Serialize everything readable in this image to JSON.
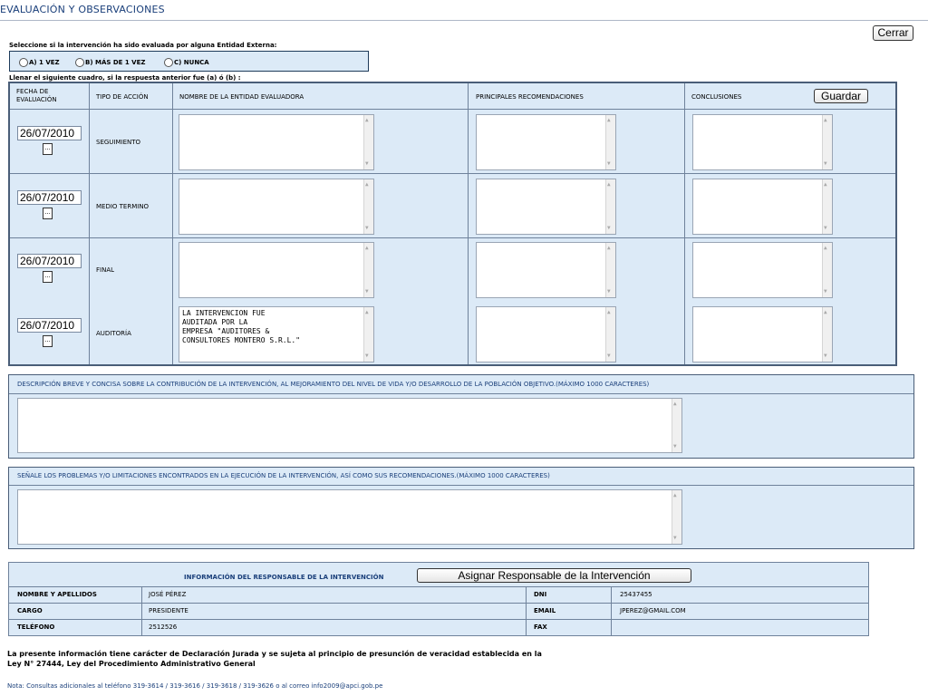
{
  "page": {
    "title": "EVALUACIÓN Y OBSERVACIONES",
    "close_label": "Cerrar"
  },
  "external_eval": {
    "question": "Seleccione si la intervención ha sido evaluada por alguna Entidad Externa:",
    "options": [
      "A) 1 VEZ",
      "B) MÁS DE 1 VEZ",
      "C) NUNCA"
    ],
    "fill_instruction": "Llenar el siguiente cuadro, si la respuesta anterior fue (a) ó (b) :"
  },
  "eval_table": {
    "headers": {
      "date": "FECHA DE EVALUACIÓN",
      "action": "TIPO DE ACCIÓN",
      "entity": "NOMBRE DE LA ENTIDAD EVALUADORA",
      "recommendations": "PRINCIPALES RECOMENDACIONES",
      "conclusions": "CONCLUSIONES"
    },
    "save_label": "Guardar",
    "calendar_button_label": "...",
    "rows": [
      {
        "date": "26/07/2010",
        "action": "SEGUIMIENTO",
        "entity": "",
        "recommendations": "",
        "conclusions": ""
      },
      {
        "date": "26/07/2010",
        "action": "MEDIO TERMINO",
        "entity": "",
        "recommendations": "",
        "conclusions": ""
      },
      {
        "date": "26/07/2010",
        "action": "FINAL",
        "entity": "",
        "recommendations": "",
        "conclusions": ""
      },
      {
        "date": "26/07/2010",
        "action": "AUDITORÍA",
        "entity": "LA INTERVENCION FUE\nAUDITADA POR LA\nEMPRESA \"AUDITORES &\nCONSULTORES MONTERO S.R.L.\"",
        "recommendations": "",
        "conclusions": ""
      }
    ]
  },
  "description": {
    "label": "DESCRIPCIÓN BREVE Y CONCISA SOBRE LA CONTRIBUCIÓN DE LA INTERVENCIÓN, AL MEJORAMIENTO DEL NIVEL DE VIDA Y/O DESARROLLO DE LA POBLACIÓN OBJETIVO.(MÁXIMO 1000 CARACTERES)",
    "value": ""
  },
  "problems": {
    "label": "SEÑALE LOS PROBLEMAS Y/O LIMITACIONES ENCONTRADOS EN LA EJECUCIÓN DE LA INTERVENCIÓN, ASÍ COMO SUS RECOMENDACIONES.(MÁXIMO 1000 CARACTERES)",
    "value": ""
  },
  "responsible": {
    "title": "INFORMACIÓN DEL RESPONSABLE DE LA INTERVENCIÓN",
    "assign_label": "Asignar Responsable de la Intervención",
    "labels": {
      "name": "NOMBRE Y APELLIDOS",
      "position": "CARGO",
      "phone": "TELÉFONO",
      "dni": "DNI",
      "email": "EMAIL",
      "fax": "FAX"
    },
    "values": {
      "name": "JOSÉ PÉREZ",
      "position": "PRESIDENTE",
      "phone": "2512526",
      "dni": "25437455",
      "email": "JPEREZ@GMAIL.COM",
      "fax": ""
    }
  },
  "footer": {
    "declaration_line1": "La presente información tiene carácter de Declaración Jurada y se sujeta al principio de presunción de veracidad establecida en la",
    "declaration_line2": "Ley N° 27444, Ley del Procedimiento Administrativo General",
    "note": "Nota: Consultas adicionales al teléfono 319-3614 / 319-3616 / 319-3618 / 319-3626 o al correo info2009@apci.gob.pe"
  }
}
